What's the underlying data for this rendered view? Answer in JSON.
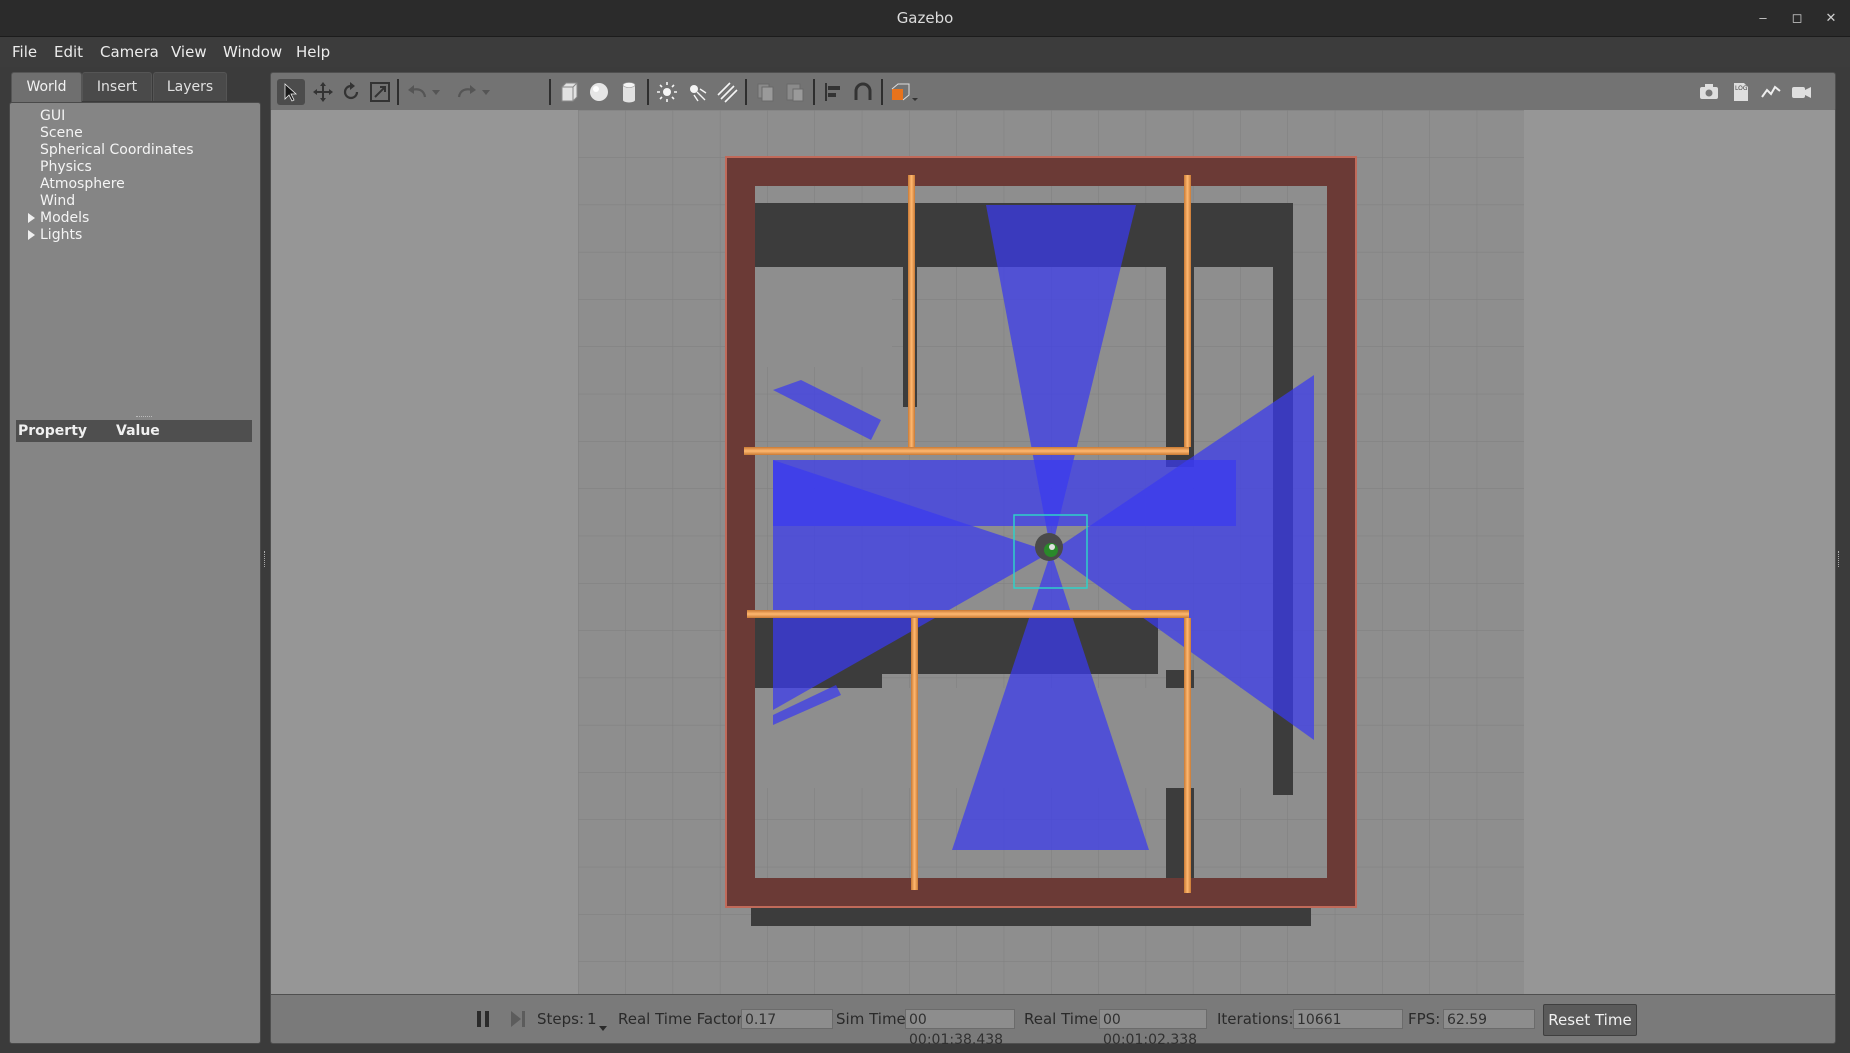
{
  "window": {
    "title": "Gazebo",
    "minimize": "–",
    "maximize": "◻",
    "close": "✕"
  },
  "menu": [
    "File",
    "Edit",
    "Camera",
    "View",
    "Window",
    "Help"
  ],
  "tabs": [
    "World",
    "Insert",
    "Layers"
  ],
  "world_tree": [
    "GUI",
    "Scene",
    "Spherical Coordinates",
    "Physics",
    "Atmosphere",
    "Wind",
    "Models",
    "Lights"
  ],
  "property_panel": {
    "property": "Property",
    "value": "Value"
  },
  "toolbar": {
    "left_tools": [
      "select-icon",
      "translate-icon",
      "rotate-icon",
      "scale-icon",
      "undo-icon",
      "undo-history-icon",
      "redo-icon",
      "redo-history-icon",
      "box-icon",
      "sphere-icon",
      "cylinder-icon",
      "point-light-icon",
      "spot-light-icon",
      "directional-light-icon",
      "copy-icon",
      "paste-icon",
      "align-icon",
      "snap-icon",
      "view-angle-icon"
    ],
    "right_tools": [
      "screenshot-icon",
      "log-icon",
      "plot-icon",
      "video-record-icon"
    ]
  },
  "statusbar": {
    "steps_label": "Steps:",
    "steps_value": "1",
    "rtf_label": "Real Time Factor:",
    "rtf_value": "0.17",
    "sim_time_label": "Sim Time:",
    "sim_time_value": "00 00:01:38.438",
    "real_time_label": "Real Time:",
    "real_time_value": "00 00:01:02.338",
    "iterations_label": "Iterations:",
    "iterations_value": "10661",
    "fps_label": "FPS:",
    "fps_value": "62.59",
    "reset_label": "Reset Time"
  },
  "colors": {
    "laser": "#3333ee",
    "wall_orange": "#e8913c",
    "wall_outer": "#6a3a36",
    "selection": "#2fd0c8",
    "robot": "#2a8a2a"
  }
}
